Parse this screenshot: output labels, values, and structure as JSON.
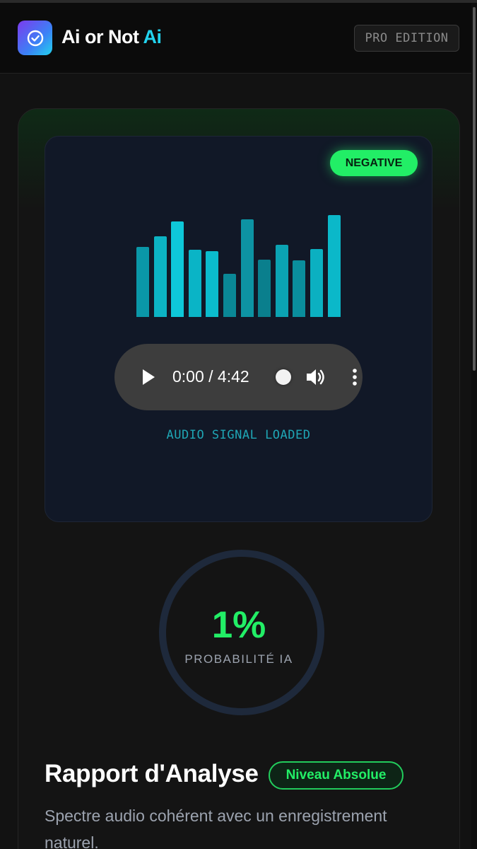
{
  "header": {
    "logo_icon": "check-circle-icon",
    "title_main": "Ai or Not ",
    "title_accent": "Ai",
    "edition_badge": "PRO EDITION"
  },
  "audio_panel": {
    "status_badge": "NEGATIVE",
    "visualizer_levels": [
      0.66,
      0.76,
      0.9,
      0.63,
      0.62,
      0.41,
      0.92,
      0.54,
      0.68,
      0.53,
      0.64,
      0.96
    ],
    "player": {
      "time": "0:00 / 4:42",
      "play_icon": "play-icon",
      "volume_icon": "volume-icon",
      "more_icon": "more-vertical-icon"
    },
    "signal_status": "AUDIO SIGNAL LOADED"
  },
  "probability": {
    "value": "1%",
    "label": "PROBABILITÉ IA",
    "fraction": 0.01
  },
  "report": {
    "title": "Rapport d'Analyse",
    "level_badge": "Niveau Absolue",
    "description": "Spectre audio cohérent avec un enregistrement naturel."
  },
  "colors": {
    "accent_cyan": "#22d3ee",
    "accent_green": "#22ee66",
    "panel_bg": "#111827",
    "page_bg": "#121212"
  }
}
